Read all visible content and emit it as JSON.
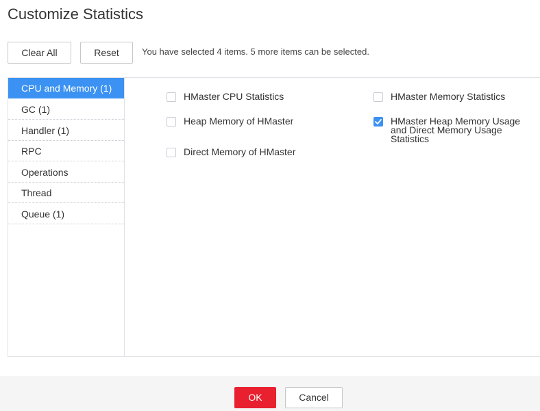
{
  "dialog": {
    "title": "Customize Statistics"
  },
  "toolbar": {
    "clear_all_label": "Clear All",
    "reset_label": "Reset",
    "selection_info": "You have selected 4 items. 5 more items can be selected."
  },
  "categories": [
    {
      "label": "CPU and Memory (1)",
      "active": true
    },
    {
      "label": "GC (1)",
      "active": false
    },
    {
      "label": "Handler (1)",
      "active": false
    },
    {
      "label": "RPC",
      "active": false
    },
    {
      "label": "Operations",
      "active": false
    },
    {
      "label": "Thread",
      "active": false
    },
    {
      "label": "Queue (1)",
      "active": false
    }
  ],
  "metrics": [
    {
      "label": "HMaster CPU Statistics",
      "checked": false
    },
    {
      "label": "HMaster Memory Statistics",
      "checked": false
    },
    {
      "label": "Heap Memory of HMaster",
      "checked": false
    },
    {
      "label": "HMaster Heap Memory Usage and Direct Memory Usage Statistics",
      "checked": true
    },
    {
      "label": "Direct Memory of HMaster",
      "checked": false
    }
  ],
  "footer": {
    "ok_label": "OK",
    "cancel_label": "Cancel"
  },
  "colors": {
    "accent": "#3b92f2",
    "primary_button": "#e8202f"
  }
}
